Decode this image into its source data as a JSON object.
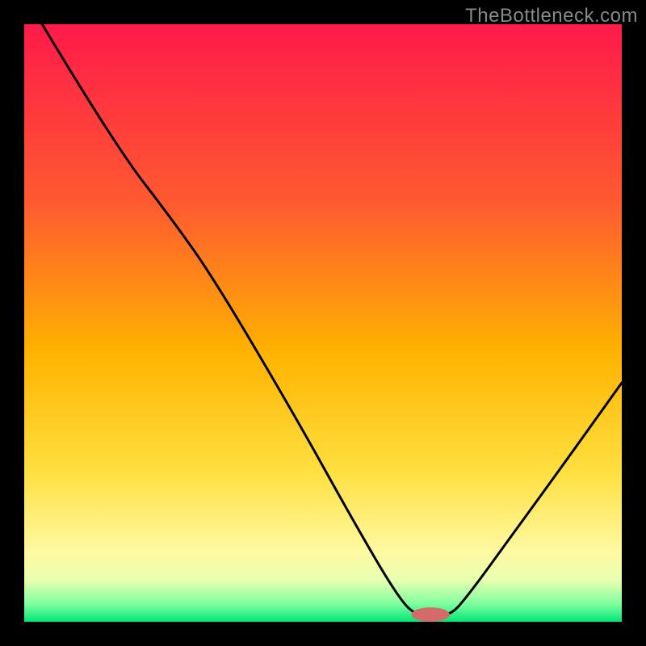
{
  "watermark": "TheBottleneck.com",
  "chart_data": {
    "type": "line",
    "title": "",
    "xlabel": "",
    "ylabel": "",
    "xlim": [
      0,
      100
    ],
    "ylim": [
      0,
      100
    ],
    "background_gradient": {
      "stops": [
        {
          "offset": 0.0,
          "color": "#ff1a4a"
        },
        {
          "offset": 0.3,
          "color": "#ff5a30"
        },
        {
          "offset": 0.55,
          "color": "#ffb300"
        },
        {
          "offset": 0.75,
          "color": "#ffe040"
        },
        {
          "offset": 0.88,
          "color": "#fff9a0"
        },
        {
          "offset": 0.93,
          "color": "#e8ffb0"
        },
        {
          "offset": 0.97,
          "color": "#80ff9e"
        },
        {
          "offset": 1.0,
          "color": "#00e676"
        }
      ]
    },
    "curve": {
      "points": [
        {
          "x": 3,
          "y": 100
        },
        {
          "x": 15,
          "y": 80
        },
        {
          "x": 25,
          "y": 67
        },
        {
          "x": 32,
          "y": 57
        },
        {
          "x": 45,
          "y": 35
        },
        {
          "x": 55,
          "y": 17
        },
        {
          "x": 62,
          "y": 5
        },
        {
          "x": 65.5,
          "y": 0.8
        },
        {
          "x": 71,
          "y": 0.8
        },
        {
          "x": 74,
          "y": 4
        },
        {
          "x": 82,
          "y": 15
        },
        {
          "x": 90,
          "y": 26
        },
        {
          "x": 100,
          "y": 40
        }
      ],
      "color": "#000000",
      "width": 3
    },
    "marker": {
      "cx": 68,
      "cy": 1.2,
      "rx": 3.2,
      "ry": 1.2,
      "color": "#d46a6a"
    }
  }
}
